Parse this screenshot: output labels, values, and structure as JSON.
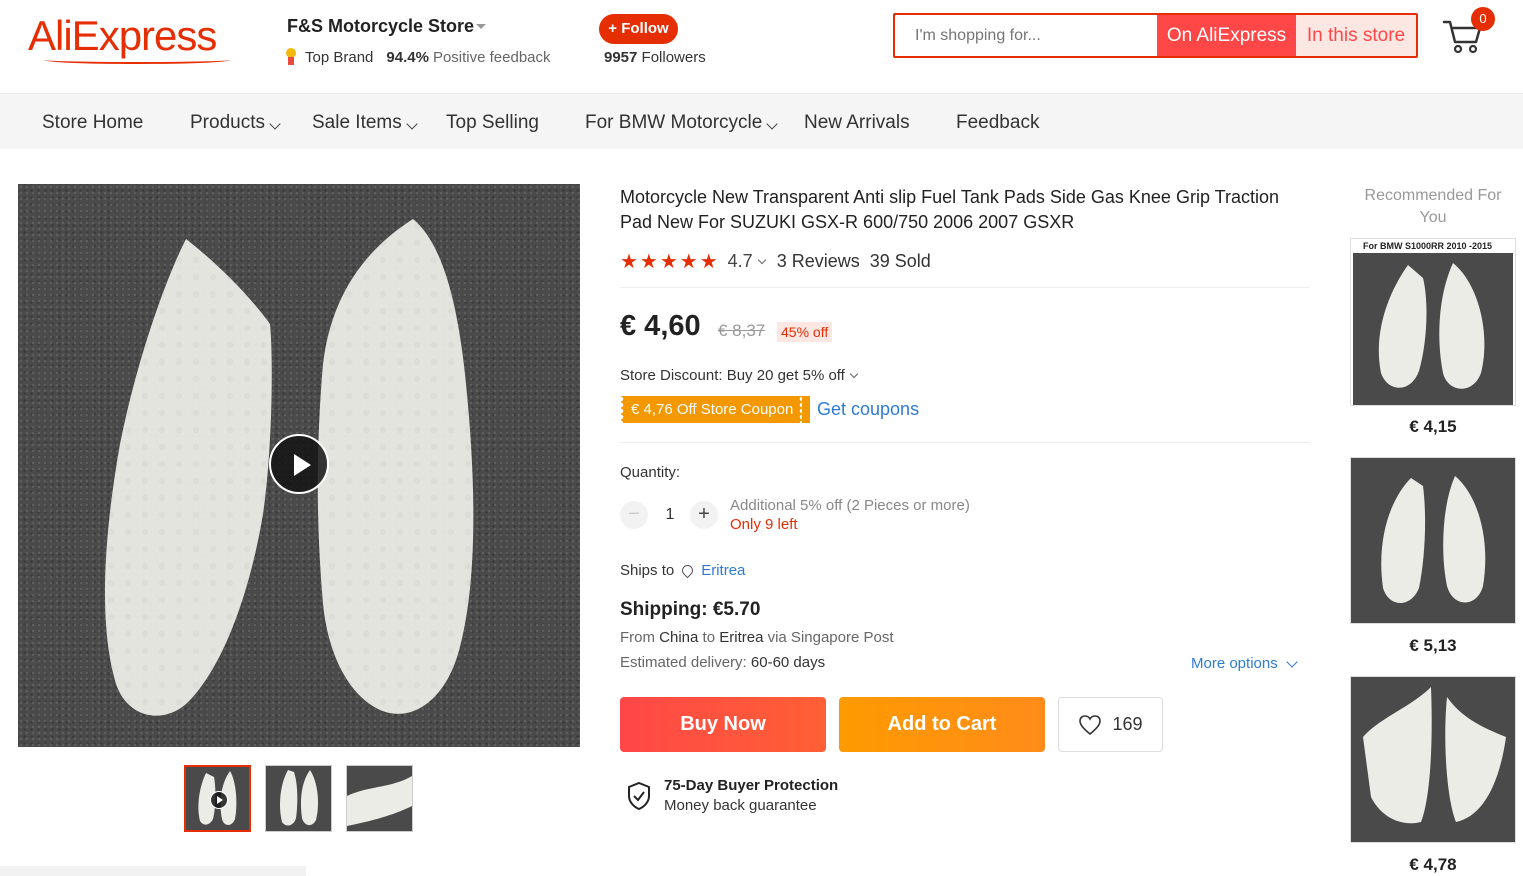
{
  "header": {
    "logo_text": "AliExpress",
    "store_name": "F&S Motorcycle Store",
    "top_brand": "Top Brand",
    "positive_pct": "94.4%",
    "positive_label": "Positive feedback",
    "follow_label": "+ Follow",
    "followers_count": "9957",
    "followers_label": "Followers",
    "search_placeholder": "I'm shopping for...",
    "search_on_site": "On AliExpress",
    "search_in_store": "In this store",
    "cart_count": "0"
  },
  "nav": {
    "items": [
      {
        "label": "Store Home"
      },
      {
        "label": "Products"
      },
      {
        "label": "Sale Items"
      },
      {
        "label": "Top Selling"
      },
      {
        "label": "For BMW Motorcycle"
      },
      {
        "label": "New Arrivals"
      },
      {
        "label": "Feedback"
      }
    ]
  },
  "product": {
    "title": "Motorcycle New Transparent Anti slip Fuel Tank Pads Side Gas Knee Grip Traction Pad New For SUZUKI GSX-R 600/750 2006 2007 GSXR",
    "stars": "★★★★★",
    "rating": "4.7",
    "reviews": "3 Reviews",
    "sold": "39 Sold",
    "price": "€ 4,60",
    "original_price": "€ 8,37",
    "discount": "45% off",
    "store_discount": "Store Discount: Buy 20 get 5% off",
    "coupon": "€ 4,76 Off Store Coupon",
    "get_coupons": "Get coupons",
    "quantity_label": "Quantity:",
    "quantity_value": "1",
    "qty_minus": "−",
    "qty_plus": "+",
    "qty_note": "Additional 5% off (2 Pieces or more)",
    "qty_left": "Only 9 left",
    "ships_to_label": "Ships to",
    "ships_to_country": "Eritrea",
    "shipping_cost": "Shipping: €5.70",
    "ship_from_prefix": "From",
    "ship_from_origin": "China",
    "ship_from_to": "to",
    "ship_from_dest": "Eritrea",
    "ship_from_via": "via Singapore Post",
    "estimated_label": "Estimated delivery:",
    "estimated_value": "60-60 days",
    "more_options": "More options",
    "buy_now": "Buy Now",
    "add_to_cart": "Add to Cart",
    "wishlist_count": "169",
    "protection_title": "75-Day Buyer Protection",
    "protection_sub": "Money back guarantee"
  },
  "recommended": {
    "heading": "Recommended For You",
    "items": [
      {
        "caption": "For BMW  S1000RR 2010 -2015",
        "price": "€ 4,15"
      },
      {
        "price": "€ 5,13"
      },
      {
        "price": "€ 4,78"
      }
    ]
  },
  "colors": {
    "brand": "#e62e04",
    "buy_now": "#ff4747",
    "add_to_cart": "#ff9a00",
    "coupon": "#f39800",
    "link": "#2e7bd6"
  }
}
